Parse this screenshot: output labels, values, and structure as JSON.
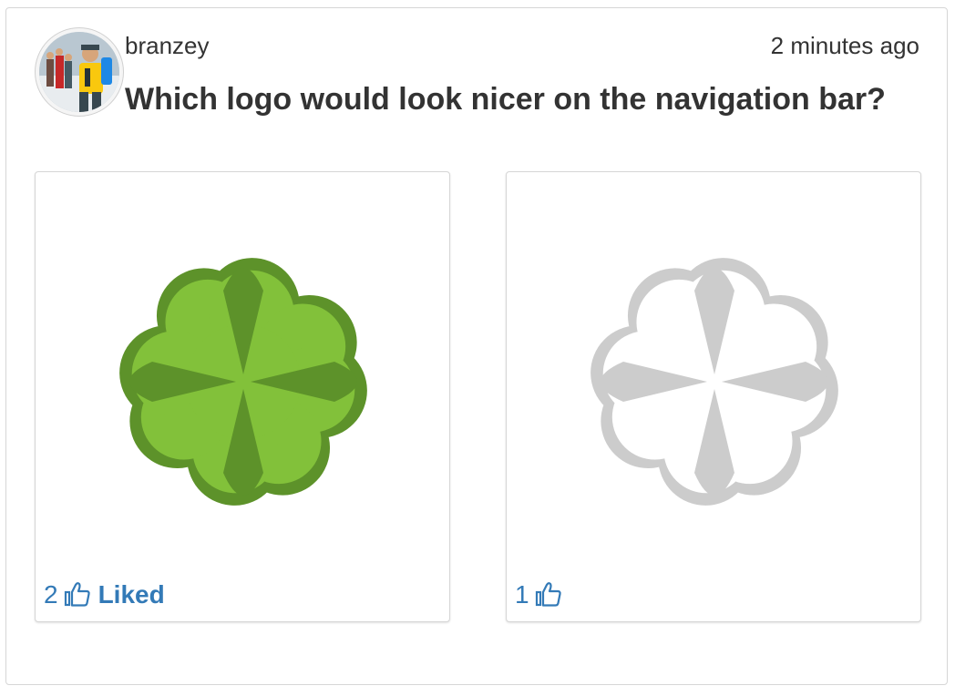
{
  "post": {
    "username": "branzey",
    "timestamp": "2 minutes ago",
    "question": "Which logo would look nicer on the navigation bar?",
    "avatar_icon": "user-avatar-photo"
  },
  "options": [
    {
      "likes": "2",
      "liked_label": "Liked",
      "liked": true,
      "logo_colors": {
        "outer": "#5d922a",
        "inner": "#82c13a",
        "petal": "#5d922a"
      }
    },
    {
      "likes": "1",
      "liked_label": "",
      "liked": false,
      "logo_colors": {
        "outer": "#cccccc",
        "inner": "#ffffff",
        "petal": "#cccccc"
      }
    }
  ],
  "colors": {
    "link": "#337ab7",
    "text": "#333333",
    "border": "#d6d6d6"
  },
  "icons": {
    "like": "thumbs-up-icon"
  }
}
